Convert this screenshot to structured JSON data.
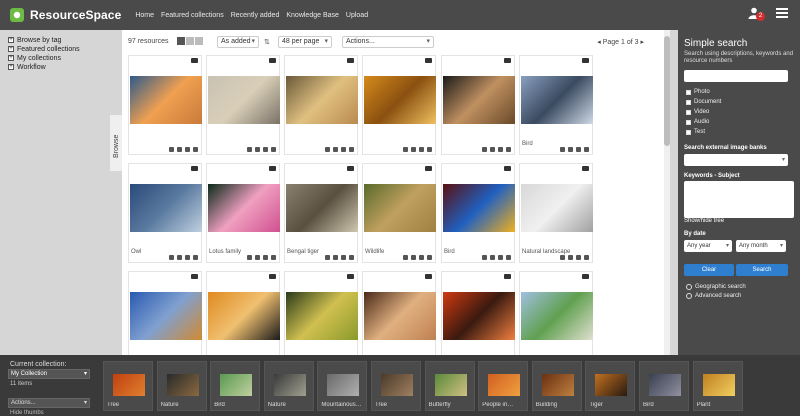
{
  "header": {
    "app_name": "ResourceSpace",
    "nav": [
      "Home",
      "Featured collections",
      "Recently added",
      "Knowledge Base",
      "Upload"
    ],
    "notification_count": "2"
  },
  "browse": {
    "items": [
      "Browse by tag",
      "Featured collections",
      "My collections",
      "Workflow"
    ],
    "tab_label": "Browse"
  },
  "toolbar": {
    "resource_count": "97 resources",
    "sort_value": "As added",
    "per_page_value": "48 per page",
    "actions_value": "Actions...",
    "pager": "Page 1 of 3"
  },
  "results": [
    {
      "title": "",
      "colors": [
        "#2e5a8a",
        "#c97a3a",
        "#f0a050"
      ]
    },
    {
      "title": "",
      "colors": [
        "#c9c1b3",
        "#7a7266",
        "#d9cfb8"
      ]
    },
    {
      "title": "",
      "colors": [
        "#6a5a3a",
        "#b88a50",
        "#e0c080"
      ]
    },
    {
      "title": "",
      "colors": [
        "#d58a1c",
        "#f0c060",
        "#8a5010"
      ]
    },
    {
      "title": "",
      "colors": [
        "#1a1a1a",
        "#6a4a2a",
        "#c09060"
      ]
    },
    {
      "title": "Bird",
      "colors": [
        "#8aa0c0",
        "#cfd9e6",
        "#3a4a60"
      ]
    },
    {
      "title": "Owl",
      "colors": [
        "#2a4a7a",
        "#c0d0e0",
        "#5a7aa0"
      ]
    },
    {
      "title": "Lotus family",
      "colors": [
        "#0a2a1a",
        "#d05090",
        "#f0a0c0"
      ]
    },
    {
      "title": "Bengal tiger",
      "colors": [
        "#8a8070",
        "#d0c8b0",
        "#5a5040"
      ]
    },
    {
      "title": "Wildlife",
      "colors": [
        "#5a6a2a",
        "#a08040",
        "#c0a060"
      ]
    },
    {
      "title": "Bird",
      "colors": [
        "#5a1010",
        "#f0b020",
        "#2060c0"
      ]
    },
    {
      "title": "Natural landscape",
      "colors": [
        "#d8d8d8",
        "#a0a0a0",
        "#f0f0f0"
      ]
    },
    {
      "title": "",
      "colors": [
        "#2a5ab0",
        "#d08a30",
        "#80a0d0"
      ]
    },
    {
      "title": "",
      "colors": [
        "#e08a20",
        "#1a1a1a",
        "#f0c070"
      ]
    },
    {
      "title": "",
      "colors": [
        "#2a3a1a",
        "#8a9a2a",
        "#d0c050"
      ]
    },
    {
      "title": "",
      "colors": [
        "#4a2a1a",
        "#c08050",
        "#e0b080"
      ]
    },
    {
      "title": "",
      "colors": [
        "#d03a10",
        "#f08040",
        "#3a1a10"
      ]
    },
    {
      "title": "",
      "colors": [
        "#a0c0e0",
        "#e0e0d0",
        "#60a050"
      ]
    }
  ],
  "search": {
    "title": "Simple search",
    "description": "Search using descriptions, keywords and resource numbers",
    "types": [
      "Photo",
      "Document",
      "Video",
      "Audio",
      "Test"
    ],
    "external_label": "Search external image banks",
    "keywords_label": "Keywords - Subject",
    "tree_label": "Show/hide tree",
    "date_label": "By date",
    "year_value": "Any year",
    "month_value": "Any month",
    "clear_label": "Clear",
    "search_label": "Search",
    "geo_label": "Geographic search",
    "advanced_label": "Advanced search"
  },
  "collection": {
    "label": "Current collection:",
    "selected": "My Collection",
    "count": "11 items",
    "actions": "Actions...",
    "hide_thumbs": "Hide thumbs",
    "items": [
      {
        "label": "Tree",
        "colors": [
          "#c04010",
          "#e08030"
        ]
      },
      {
        "label": "Nature",
        "colors": [
          "#2a2a2a",
          "#8a6a40"
        ]
      },
      {
        "label": "Bird",
        "colors": [
          "#5a9a50",
          "#c0d0a0"
        ]
      },
      {
        "label": "Nature",
        "colors": [
          "#3a3a3a",
          "#a0a090"
        ]
      },
      {
        "label": "Mountainous…",
        "colors": [
          "#6a6a6a",
          "#b0b0b0"
        ]
      },
      {
        "label": "Tree",
        "colors": [
          "#4a3a2a",
          "#a08060"
        ]
      },
      {
        "label": "Butterfly",
        "colors": [
          "#5a8a3a",
          "#d0c080"
        ]
      },
      {
        "label": "People in…",
        "colors": [
          "#d06020",
          "#f0a040"
        ]
      },
      {
        "label": "Building",
        "colors": [
          "#6a3010",
          "#c08040"
        ]
      },
      {
        "label": "Tiger",
        "colors": [
          "#c07020",
          "#2a1a10"
        ]
      },
      {
        "label": "Bird",
        "colors": [
          "#3a4050",
          "#9090a0"
        ]
      },
      {
        "label": "Plant",
        "colors": [
          "#c08020",
          "#f0d060"
        ]
      }
    ]
  }
}
